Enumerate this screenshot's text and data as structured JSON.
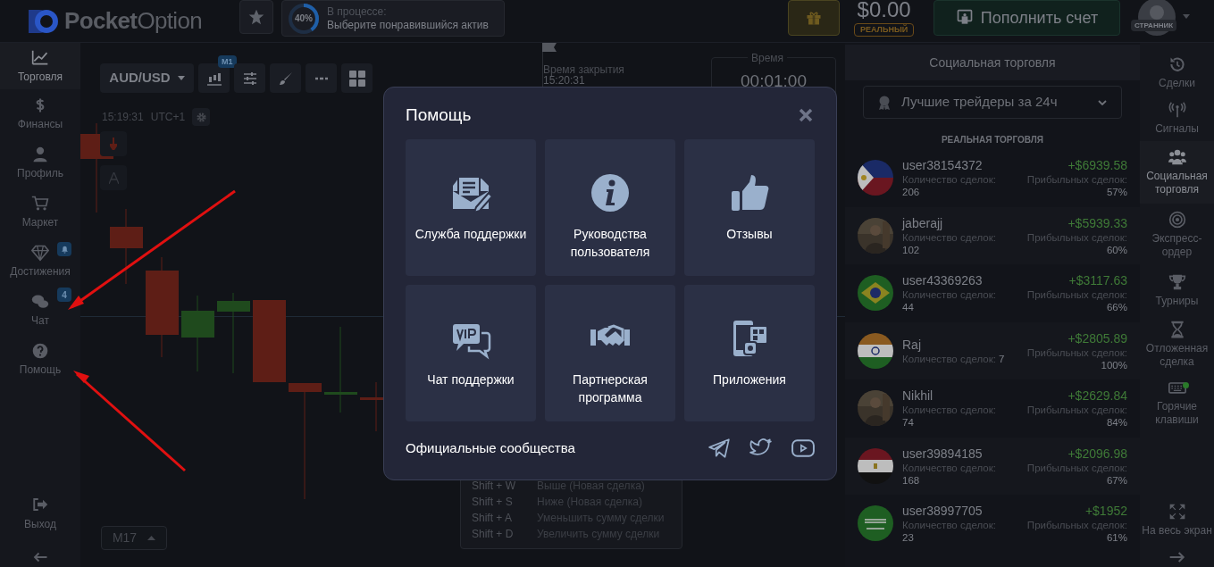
{
  "header": {
    "logo": {
      "bold": "Pocket",
      "light": "Option"
    },
    "progress": {
      "percent": "40%",
      "label": "В процессе:",
      "text": "Выберите понравившийся актив"
    },
    "balance": "$0.00",
    "account_badge": "РЕАЛЬНЫЙ",
    "deposit_button": "Пополнить счет",
    "user_badge": "СТРАННИК"
  },
  "left_nav": {
    "items": [
      {
        "kind": "chart",
        "label": "Торговля",
        "selected": true,
        "alert": false
      },
      {
        "kind": "dollar",
        "label": "Финансы",
        "selected": false,
        "alert": false
      },
      {
        "kind": "user",
        "label": "Профиль",
        "selected": false,
        "alert": false
      },
      {
        "kind": "cart",
        "label": "Маркет",
        "selected": false,
        "alert": false
      },
      {
        "kind": "diamond",
        "label": "Достижения",
        "selected": false,
        "alert": true
      },
      {
        "kind": "chat",
        "label": "Чат",
        "selected": false,
        "alert": false,
        "badge": "4"
      },
      {
        "kind": "help",
        "label": "Помощь",
        "selected": false,
        "alert": false
      }
    ],
    "bottom": [
      {
        "kind": "exit",
        "label": "Выход"
      },
      {
        "kind": "arrow-left"
      }
    ]
  },
  "chart": {
    "asset": "AUD/USD",
    "timeframe_badge": "M1",
    "time": "15:19:31",
    "timezone": "UTC+1",
    "close_label": "Время закрытия",
    "close_time": "15:20:31",
    "period_button": "M17"
  },
  "trade_panel": {
    "time_label": "Время",
    "time_value": "00:01:00"
  },
  "hotkeys_popup": {
    "rows": [
      {
        "keys": "Shift + W",
        "action": "Выше (Новая сделка)"
      },
      {
        "keys": "Shift + S",
        "action": "Ниже (Новая сделка)"
      },
      {
        "keys": "Shift + A",
        "action": "Уменьшить сумму сделки"
      },
      {
        "keys": "Shift + D",
        "action": "Увеличить сумму сделки"
      }
    ]
  },
  "social": {
    "title": "Социальная торговля",
    "filter": "Лучшие трейдеры за 24ч",
    "section": "РЕАЛЬНАЯ ТОРГОВЛЯ",
    "traders": [
      {
        "kind": "flag",
        "name": "user38154372",
        "deals_label": "Количество сделок:",
        "deals": "206",
        "profit": "+$6939.58",
        "win_label": "Прибыльных сделок:",
        "win": "57%"
      },
      {
        "kind": "picture",
        "name": "jaberajj",
        "deals_label": "Количество сделок:",
        "deals": "102",
        "profit": "+$5939.33",
        "win_label": "Прибыльных сделок:",
        "win": "60%"
      },
      {
        "kind": "flag",
        "name": "user43369263",
        "deals_label": "Количество сделок:",
        "deals": "44",
        "profit": "+$3117.63",
        "win_label": "Прибыльных сделок:",
        "win": "66%"
      },
      {
        "kind": "flag",
        "name": "Raj",
        "deals_label": "Количество сделок:",
        "deals": "7",
        "profit": "+$2805.89",
        "win_label": "Прибыльных сделок:",
        "win": "100%"
      },
      {
        "kind": "picture",
        "name": "Nikhil",
        "deals_label": "Количество сделок:",
        "deals": "74",
        "profit": "+$2629.84",
        "win_label": "Прибыльных сделок:",
        "win": "84%"
      },
      {
        "kind": "flag",
        "name": "user39894185",
        "deals_label": "Количество сделок:",
        "deals": "168",
        "profit": "+$2096.98",
        "win_label": "Прибыльных сделок:",
        "win": "67%"
      },
      {
        "kind": "flag",
        "name": "user38997705",
        "deals_label": "Количество сделок:",
        "deals": "23",
        "profit": "+$1952",
        "win_label": "Прибыльных сделок:",
        "win": "61%"
      }
    ]
  },
  "right_nav": {
    "items": [
      {
        "kind": "history",
        "label": "Сделки",
        "selected": false,
        "dot": false
      },
      {
        "kind": "signal",
        "label": "Сигналы",
        "selected": false,
        "dot": false
      },
      {
        "kind": "users",
        "label": "Социальная торговля",
        "selected": true,
        "dot": false
      },
      {
        "kind": "target",
        "label": "Экспресс-ордер",
        "selected": false,
        "dot": false
      },
      {
        "kind": "trophy",
        "label": "Турниры",
        "selected": false,
        "dot": false
      },
      {
        "kind": "hourglass",
        "label": "Отложенная сделка",
        "selected": false,
        "dot": false
      },
      {
        "kind": "keyboard",
        "label": "Горячие клавиши",
        "selected": false,
        "dot": true
      },
      {
        "kind": "fullscreen",
        "label": "На весь экран",
        "selected": false,
        "dot": false
      },
      {
        "kind": "arrow-right",
        "selected": false,
        "dot": false
      }
    ]
  },
  "help_modal": {
    "title": "Помощь",
    "tiles": [
      {
        "kind": "support",
        "label": "Служба поддержки"
      },
      {
        "kind": "info",
        "label": "Руководства пользователя"
      },
      {
        "kind": "like",
        "label": "Отзывы"
      },
      {
        "kind": "vip",
        "label": "Чат поддержки"
      },
      {
        "kind": "handshake",
        "label": "Партнерская программа"
      },
      {
        "kind": "apps",
        "label": "Приложения"
      }
    ],
    "footer": "Официальные сообщества",
    "socials": [
      {
        "kind": "telegram"
      },
      {
        "kind": "twitter"
      },
      {
        "kind": "youtube"
      }
    ]
  }
}
